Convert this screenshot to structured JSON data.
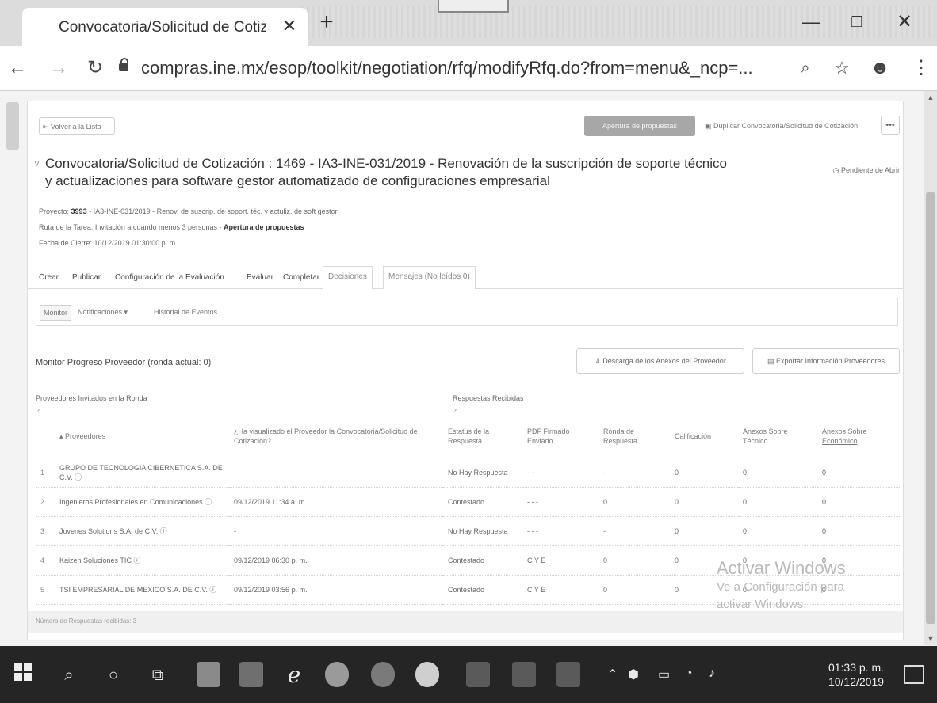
{
  "browser": {
    "tab_title": "Convocatoria/Solicitud de Cotiza",
    "url": "compras.ine.mx/esop/toolkit/negotiation/rfq/modifyRfq.do?from=menu&_ncp=..."
  },
  "page": {
    "back_label": "Volver a la Lista",
    "primary_action": "Apertura de propuestas",
    "duplicate_label": "Duplicar Convocatoria/Solicitud de Cotización",
    "more_label": "•••",
    "title": "Convocatoria/Solicitud de Cotización : 1469 - IA3-INE-031/2019 - Renovación de la suscripción de soporte técnico y actualizaciones para software gestor automatizado de configuraciones empresarial",
    "status": "Pendiente de Abrir",
    "meta": {
      "project_label": "Proyecto:",
      "project_code": "3993",
      "project_value": "- IA3-INE-031/2019 - Renov. de suscrip. de soport. téc. y actuliz. de soft gestor",
      "route_label": "Ruta de la Tarea:",
      "route_value": "Invitación a cuando menos 3 personas -",
      "route_stage": "Apertura de propuestas",
      "close_label": "Fecha de Cierre:",
      "close_value": "10/12/2019 01:30:00 p. m."
    },
    "tabs": [
      "Crear",
      "Publicar",
      "Configuración de la Evaluación",
      "Evaluar",
      "Completar",
      "Decisiones",
      "Mensajes (No leídos 0)"
    ],
    "subtabs": [
      "Monitor",
      "Notificaciones",
      "Historial de Eventos"
    ],
    "subtab_chevron": "▾",
    "section_title": "Monitor Progreso Proveedor (ronda actual: 0)",
    "download_button": "Descarga de los Anexos del Proveedor",
    "export_button": "Exportar Información Proveedores",
    "invited_label": "Proveedores Invitados en la Ronda",
    "received_label": "Respuestas Recibidas",
    "chevron": "›",
    "table": {
      "headers": [
        "",
        "Proveedores",
        "¿Ha visualizado el Proveedor la Convocatoria/Solicitud de Cotización?",
        "Estatus de la Respuesta",
        "PDF Firmado Enviado",
        "Ronda de Respuesta",
        "Calificación",
        "Anexos Sobre Técnico",
        "Anexos Sobre Económico"
      ],
      "sort_glyph": "▴",
      "rows": [
        [
          "1",
          "GRUPO DE TECNOLOGIA CIBERNETICA S.A. DE C.V. ⓘ",
          "-",
          "No Hay Respuesta",
          "- - -",
          "-",
          "0",
          "0",
          "0"
        ],
        [
          "2",
          "Ingenieros Profesionales en Comunicaciones ⓘ",
          "09/12/2019 11:34 a. m.",
          "Contestado",
          "- - -",
          "0",
          "0",
          "0",
          "0"
        ],
        [
          "3",
          "Jovenes Solutions S.A. de C.V. ⓘ",
          "-",
          "No Hay Respuesta",
          "- - -",
          "-",
          "0",
          "0",
          "0"
        ],
        [
          "4",
          "Kaizen Soluciones TIC ⓘ",
          "09/12/2019 06:30 p. m.",
          "Contestado",
          "C Y E",
          "0",
          "0",
          "0",
          "0"
        ],
        [
          "5",
          "TSI EMPRESARIAL DE MEXICO S.A. DE C.V. ⓘ",
          "09/12/2019 03:56 p. m.",
          "Contestado",
          "C Y E",
          "0",
          "0",
          "0",
          "0"
        ]
      ]
    },
    "footer": "Número de Respuestas recibidas: 3"
  },
  "watermark": {
    "line1": "Activar Windows",
    "line2": "Ve a Configuración para",
    "line3": "activar Windows."
  },
  "taskbar": {
    "time": "01:33 p. m.",
    "date": "10/12/2019"
  }
}
